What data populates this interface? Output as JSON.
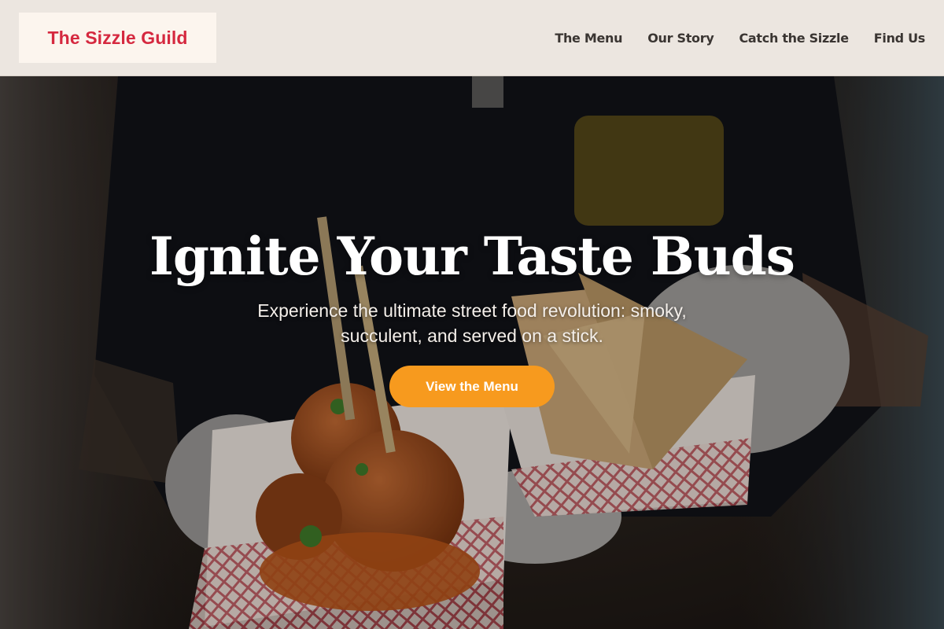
{
  "header": {
    "brand": "The Sizzle Guild",
    "nav": [
      "The Menu",
      "Our Story",
      "Catch the Sizzle",
      "Find Us"
    ]
  },
  "hero": {
    "title": "Ignite Your Taste Buds",
    "subtitle": "Experience the ultimate street food revolution: smoky, succulent, and served on a stick.",
    "cta_label": "View the Menu",
    "photo_description_icon": "street-food-photo"
  },
  "colors": {
    "brand_red": "#d5283f",
    "accent_orange": "#f79a1e",
    "header_bg": "#ece6e0"
  }
}
